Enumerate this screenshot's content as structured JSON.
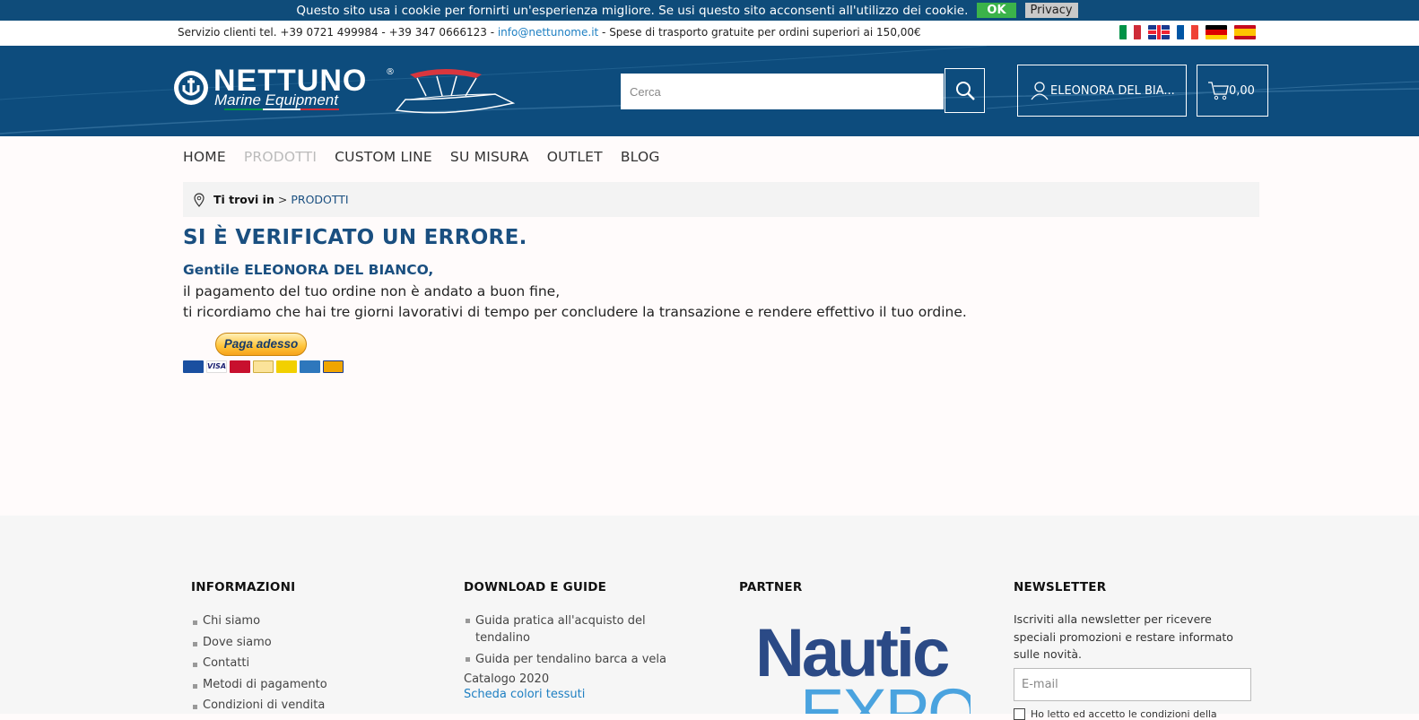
{
  "cookie_bar": {
    "message": "Questo sito usa i cookie per fornirti un'esperienza migliore. Se usi questo sito acconsenti all'utilizzo dei cookie.",
    "ok_label": "OK",
    "privacy_label": "Privacy"
  },
  "topbar": {
    "service_text": "Servizio clienti tel. +39 0721 499984 - +39 347 0666123 - ",
    "email": "info@nettunome.it",
    "shipping_text": " - Spese di trasporto gratuite per ordini superiori ai 150,00€",
    "flags": [
      {
        "name": "italian-flag-icon",
        "colors": [
          "#009246",
          "#ffffff",
          "#ce2b37"
        ]
      },
      {
        "name": "uk-flag-icon"
      },
      {
        "name": "french-flag-icon",
        "colors": [
          "#0055a4",
          "#ffffff",
          "#ef4135"
        ]
      },
      {
        "name": "german-flag-icon",
        "colors": [
          "#000000",
          "#dd0000",
          "#ffce00"
        ]
      },
      {
        "name": "spanish-flag-icon",
        "colors": [
          "#c60b1e",
          "#ffc400",
          "#c60b1e"
        ]
      }
    ]
  },
  "header": {
    "logo_brand": "NETTUNO",
    "logo_registered": "®",
    "logo_sub": "Marine Equipment",
    "search_placeholder": "Cerca",
    "account_label": "ELEONORA DEL BIA...",
    "cart_total": "0,00",
    "colors": {
      "header_bg": "#0d4c7d",
      "accent": "#1a4f80"
    }
  },
  "nav": {
    "items": [
      "HOME",
      "PRODOTTI",
      "CUSTOM LINE",
      "SU MISURA",
      "OUTLET",
      "BLOG"
    ]
  },
  "breadcrumb": {
    "label": "Ti trovi in",
    "separator": ">",
    "current": "PRODOTTI"
  },
  "main": {
    "title": "SI È VERIFICATO UN ERRORE.",
    "greeting": "Gentile ELEONORA DEL BIANCO,",
    "line1": "il pagamento del tuo ordine non è andato a buon fine,",
    "line2": "ti ricordiamo che hai tre giorni lavorativi di tempo per concludere la transazione e rendere effettivo il tuo ordine.",
    "paypal_label": "Paga adesso",
    "card_logos": [
      "maestro",
      "visa",
      "mastercard",
      "postepay",
      "postepay-evolution",
      "amex",
      "aura"
    ]
  },
  "footer": {
    "info": {
      "heading": "INFORMAZIONI",
      "links": [
        "Chi siamo",
        "Dove siamo",
        "Contatti",
        "Metodi di pagamento",
        "Condizioni di vendita"
      ]
    },
    "downloads": {
      "heading": "DOWNLOAD E GUIDE",
      "links": [
        "Guida pratica all'acquisto del tendalino",
        "Guida per tendalino barca a vela"
      ],
      "catalog": "Catalogo 2020",
      "colors_link": "Scheda colori tessuti"
    },
    "partner": {
      "heading": "PARTNER",
      "logo_word1": "Nautic",
      "logo_word2": "EXPO"
    },
    "newsletter": {
      "heading": "NEWSLETTER",
      "text": "Iscriviti alla newsletter per ricevere speciali promozioni e restare informato sulle novità.",
      "email_placeholder": "E-mail",
      "consent": "Ho letto ed accetto le condizioni della"
    }
  }
}
